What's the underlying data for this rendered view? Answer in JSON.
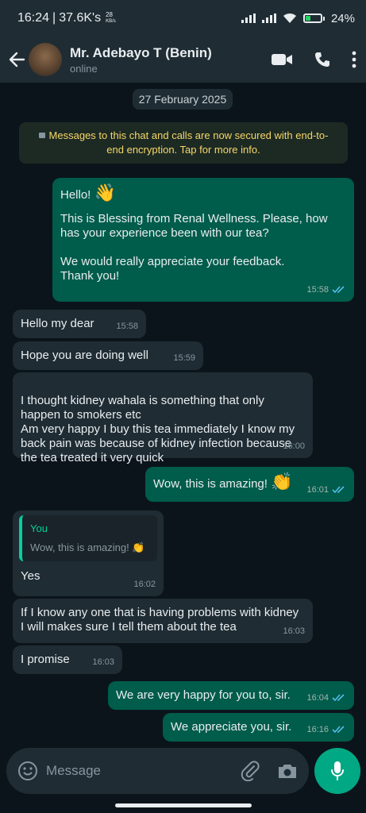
{
  "status_bar": {
    "time": "16:24",
    "separator": "|",
    "net_speed": "37.6K's",
    "kbs_value": "28",
    "kbs_unit": "KB/s",
    "battery": "24%"
  },
  "header": {
    "contact_name": "Mr. Adebayo T (Benin)",
    "contact_status": "online"
  },
  "chat": {
    "date_chip": "27 February 2025",
    "encryption_notice": "Messages to this chat and calls are now secured with end-to-end encryption. Tap for more info.",
    "messages": [
      {
        "direction": "out",
        "line1": "Hello! ",
        "emoji": "👋",
        "para2": "This is Blessing from Renal Wellness. Please, how has your experience been with our tea?",
        "para3": "We would really appreciate your feedback. Thank you!",
        "time": "15:58"
      },
      {
        "direction": "in",
        "text": "Hello my dear",
        "time": "15:58"
      },
      {
        "direction": "in",
        "text": "Hope you are doing well",
        "time": "15:59"
      },
      {
        "direction": "in",
        "text": "I thought kidney wahala is something that only happen to smokers etc\n Am very happy I buy this tea immediately I know my back pain was because of kidney infection because the tea treated it very quick",
        "time": "16:00"
      },
      {
        "direction": "out",
        "text": "Wow, this is amazing! ",
        "emoji": "👏",
        "time": "16:01"
      },
      {
        "direction": "in",
        "quote_name": "You",
        "quote_text": "Wow, this is amazing! 👏",
        "text": "Yes",
        "time": "16:02"
      },
      {
        "direction": "in",
        "text": "If I know any one that is having problems with kidney I will makes sure I tell them about the tea",
        "time": "16:03"
      },
      {
        "direction": "in",
        "text": "I promise",
        "time": "16:03"
      },
      {
        "direction": "out",
        "text": "We are very happy for you to, sir.",
        "time": "16:04"
      },
      {
        "direction": "out",
        "text": "We appreciate you, sir.",
        "time": "16:16"
      }
    ]
  },
  "composer": {
    "placeholder": "Message"
  },
  "icons": {
    "back": "arrow-left-icon",
    "video": "video-call-icon",
    "phone": "phone-call-icon",
    "menu": "more-vertical-icon",
    "emoji": "emoji-icon",
    "attach": "paperclip-icon",
    "camera": "camera-icon",
    "mic": "mic-icon"
  },
  "colors": {
    "chat_bg": "#0b141a",
    "incoming_bubble": "#1f2c34",
    "outgoing_bubble": "#005c4b",
    "accent": "#00a884",
    "read_ticks": "#53bdeb",
    "encryption_text": "#f7d66a"
  }
}
